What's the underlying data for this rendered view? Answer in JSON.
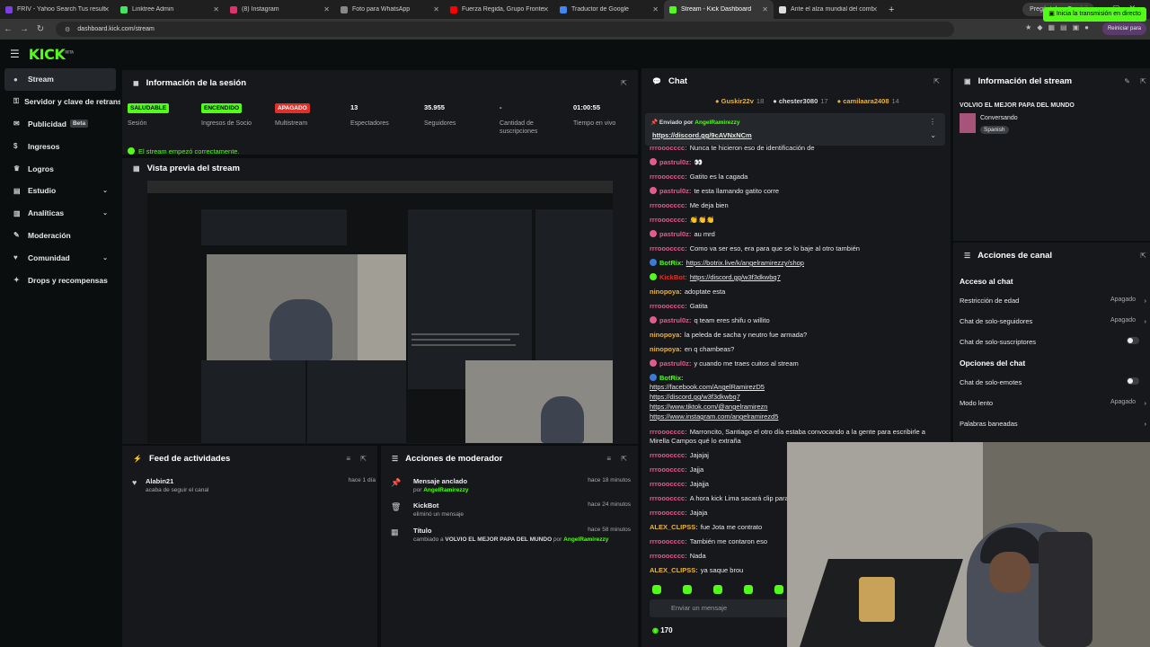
{
  "browser": {
    "tabs": [
      {
        "label": "FRIV - Yahoo Search Tus resulta",
        "color": "#7b3fe4"
      },
      {
        "label": "Linktree Admin",
        "color": "#43e660"
      },
      {
        "label": "(8) Instagram",
        "color": "#e1306c"
      },
      {
        "label": "Foto para WhatsApp",
        "color": "#888888"
      },
      {
        "label": "Fuerza Regida, Grupo Frontera",
        "color": "#ff0000"
      },
      {
        "label": "Traductor de Google",
        "color": "#4285f4"
      },
      {
        "label": "Stream - Kick Dashboard",
        "color": "#53fc18"
      },
      {
        "label": "Ante el alza mundial del combu",
        "color": "#dddddd"
      }
    ],
    "new_tab": "+",
    "gemini": "Pregúntale a Gemini",
    "url": "dashboard.kick.com/stream",
    "reboot": "Reiniciar para"
  },
  "header": {
    "logo": "KICK",
    "logo_sup": "BETA",
    "golive": "Inicia la transmisión en directo"
  },
  "sidebar": {
    "items": [
      {
        "label": "Stream",
        "icon": "signal-icon"
      },
      {
        "label": "Servidor y clave de retransmisión",
        "icon": "key-icon"
      },
      {
        "label": "Publicidad",
        "icon": "megaphone-icon",
        "badge": "Beta"
      },
      {
        "label": "Ingresos",
        "icon": "wallet-icon"
      },
      {
        "label": "Logros",
        "icon": "trophy-icon"
      },
      {
        "label": "Estudio",
        "icon": "layers-icon",
        "chevron": true
      },
      {
        "label": "Analíticas",
        "icon": "chart-icon",
        "chevron": true
      },
      {
        "label": "Moderación",
        "icon": "wrench-icon"
      },
      {
        "label": "Comunidad",
        "icon": "heart-icon",
        "chevron": true
      },
      {
        "label": "Drops y recompensas",
        "icon": "gift-icon"
      }
    ]
  },
  "session": {
    "title": "Información de la sesión",
    "stats": [
      {
        "value": "SALUDABLE",
        "label": "Sesión",
        "badge_color": "#53fc18",
        "text_color": "#000000"
      },
      {
        "value": "ENCENDIDO",
        "label": "Ingresos de Socio",
        "badge_color": "#53fc18",
        "text_color": "#000000"
      },
      {
        "value": "APAGADO",
        "label": "Multistream",
        "badge_color": "#e0302a",
        "text_color": "#ffffff"
      },
      {
        "value": "13",
        "label": "Espectadores"
      },
      {
        "value": "35.955",
        "label": "Seguidores"
      },
      {
        "value": "-",
        "label": "Cantidad de suscripciones"
      },
      {
        "value": "01:00:55",
        "label": "Tiempo en vivo"
      }
    ],
    "ok_message": "El stream empezó correctamente."
  },
  "preview": {
    "title": "Vista previa del stream"
  },
  "feed": {
    "title": "Feed de actividades",
    "items": [
      {
        "name": "Alabin21",
        "sub": "acaba de seguir el canal",
        "time": "hace 1 día"
      }
    ]
  },
  "mod": {
    "title": "Acciones de moderador",
    "items": [
      {
        "name": "Mensaje anclado",
        "sub_prefix": "por",
        "sub_user": "AngelRamirezzy",
        "sub_suffix": "",
        "time": "hace 18 minutos",
        "icon": "pin-icon"
      },
      {
        "name": "KickBot",
        "sub_prefix": "eliminó un mensaje",
        "sub_user": "",
        "sub_suffix": "",
        "time": "hace 24 minutos",
        "icon": "trash-icon"
      },
      {
        "name": "Título",
        "sub_prefix": "cambiado a",
        "sub_user": "AngelRamirezzy",
        "sub_suffix": "VOLVIO EL MEJOR PAPA DEL MUNDO",
        "sub_por": "por",
        "time": "hace 58 minutos",
        "icon": "grid-icon"
      }
    ]
  },
  "chat": {
    "title": "Chat",
    "gifters": [
      {
        "name": "Guskir22v",
        "count": "18"
      },
      {
        "name": "chester3080",
        "count": "17"
      },
      {
        "name": "camilaara2408",
        "count": "14"
      }
    ],
    "pinned": {
      "sent_by": "Enviado por",
      "user": "AngelRamirezzy",
      "link": "https://discord.gg/9cAVNxNCm"
    },
    "messages": [
      {
        "user": "rrrooocccc",
        "text": "Nunca te hicieron eso de identificación de",
        "color": "#e05d8a"
      },
      {
        "user": "pastrul0z",
        "text": "👀",
        "color": "#e05d8a",
        "icon": "#e05d8a"
      },
      {
        "user": "rrrooocccc",
        "text": "Gatito es la cagada",
        "color": "#e05d8a"
      },
      {
        "user": "pastrul0z",
        "text": "te esta llamando gatito corre",
        "color": "#e05d8a",
        "icon": "#e05d8a"
      },
      {
        "user": "rrrooocccc",
        "text": "Me deja bien",
        "color": "#e05d8a"
      },
      {
        "user": "rrrooocccc",
        "text": "👏👏👏",
        "color": "#e05d8a"
      },
      {
        "user": "pastrul0z",
        "text": "au mrd",
        "color": "#e05d8a",
        "icon": "#e05d8a"
      },
      {
        "user": "rrrooocccc",
        "text": "Como va ser eso, era para que se lo baje al otro también",
        "color": "#e05d8a"
      },
      {
        "user": "BotRix",
        "text": "https://botrix.live/k/angelramirezzy/shop",
        "color": "#53fc18",
        "icon": "#3a7bd5",
        "link": true
      },
      {
        "user": "KickBot",
        "text": "https://discord.gg/w3f3dkwbq7",
        "color": "#e0302a",
        "icon": "#53fc18",
        "link": true
      },
      {
        "user": "ninopoya",
        "text": "adoptate esta",
        "color": "#e6b33f"
      },
      {
        "user": "rrrooocccc",
        "text": "Gatita",
        "color": "#e05d8a"
      },
      {
        "user": "pastrul0z",
        "text": "q team eres shifu o willito",
        "color": "#e05d8a",
        "icon": "#e05d8a"
      },
      {
        "user": "ninopoya",
        "text": "la peleda de sacha y neutro fue armada?",
        "color": "#e6b33f"
      },
      {
        "user": "ninopoya",
        "text": "en q chambeas?",
        "color": "#e6b33f"
      },
      {
        "user": "pastrul0z",
        "text": "y cuando me traes cuitos al stream",
        "color": "#e05d8a",
        "icon": "#e05d8a"
      }
    ],
    "botrix_links": [
      "https://facebook.com/AngelRamirezD5",
      "https://discord.gg/w3f3dkwbq7",
      "https://www.tiktok.com/@angelramirezn",
      "https://www.instagram.com/angelramirezd5"
    ],
    "messages2": [
      {
        "user": "rrrooocccc",
        "text": "Marroncito, Santiago el otro día estaba convocando a la gente para escribirle a",
        "text2": "Mirella Campos qué lo extraña",
        "color": "#e05d8a"
      },
      {
        "user": "rrrooocccc",
        "text": "Jajajaj",
        "color": "#e05d8a"
      },
      {
        "user": "rrrooocccc",
        "text": "Jajja",
        "color": "#e05d8a"
      },
      {
        "user": "rrrooocccc",
        "text": "Jajajja",
        "color": "#e05d8a"
      },
      {
        "user": "rrrooocccc",
        "text": "A hora kick Lima sacará clip para",
        "color": "#e05d8a"
      },
      {
        "user": "rrrooocccc",
        "text": "Jajaja",
        "color": "#e05d8a"
      },
      {
        "user": "ALEX_CLIPSS",
        "text": "fue Jota me contrato",
        "color": "#e6b33f"
      },
      {
        "user": "rrrooocccc",
        "text": "También me contaron eso",
        "color": "#e05d8a"
      },
      {
        "user": "rrrooocccc",
        "text": "Nada",
        "color": "#e05d8a"
      },
      {
        "user": "ALEX_CLIPSS",
        "text": "ya saque brou",
        "color": "#e6b33f"
      }
    ],
    "input_placeholder": "Enviar un mensaje",
    "points": "170"
  },
  "stream_info": {
    "title": "Información del stream",
    "stream_title": "VOLVIO EL MEJOR PAPA DEL MUNDO",
    "category": "Conversando",
    "language": "Spanish"
  },
  "channel_actions": {
    "title": "Acciones de canal",
    "sections": [
      {
        "title": "Acceso al chat",
        "rows": [
          {
            "label": "Restricción de edad",
            "value": "Apagado",
            "type": "chevron"
          },
          {
            "label": "Chat de solo-seguidores",
            "value": "Apagado",
            "type": "chevron"
          },
          {
            "label": "Chat de solo-suscriptores",
            "value": "",
            "type": "toggle"
          }
        ]
      },
      {
        "title": "Opciones del chat",
        "rows": [
          {
            "label": "Chat de solo-emotes",
            "value": "",
            "type": "toggle"
          },
          {
            "label": "Modo lento",
            "value": "Apagado",
            "type": "chevron"
          },
          {
            "label": "Palabras baneadas",
            "value": "",
            "type": "chevron"
          }
        ]
      }
    ]
  }
}
